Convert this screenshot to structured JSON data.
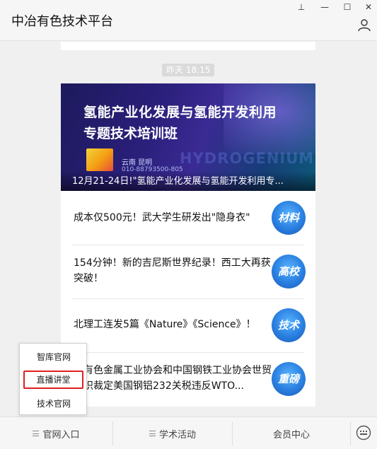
{
  "window": {
    "title": "中冶有色技术平台",
    "controls": {
      "pin": "⊥",
      "minimize": "—",
      "maximize": "☐",
      "close": "✕"
    }
  },
  "chat": {
    "timestamp": "昨天  18:15",
    "banner": {
      "title_line1": "氢能产业化发展与氢能开发利用",
      "title_line2": "专题技术培训班",
      "location": "云南 昆明",
      "phone": "010-88793500-805",
      "watermark": "HYDROGENIUM",
      "caption": "12月21-24日!\"氢能产业化发展与氢能开发利用专..."
    },
    "news": [
      {
        "text": "成本仅500元！武大学生研发出\"隐身衣\"",
        "thumb": "材料"
      },
      {
        "text": "154分钟！新的吉尼斯世界纪录！西工大再获突破！",
        "thumb": "高校"
      },
      {
        "text": "北理工连发5篇《Nature》《Science》！",
        "thumb": "技术"
      },
      {
        "text": "国有色金属工业协会和中国钢铁工业协会世贸组织裁定美国钢铝232关税违反WTO...",
        "thumb": "重磅"
      }
    ]
  },
  "popup_menu": {
    "items": [
      {
        "label": "智库官网"
      },
      {
        "label": "直播讲堂",
        "highlighted": true
      },
      {
        "label": "技术官网"
      }
    ],
    "highlight_color": "#e02020"
  },
  "bottom_menu": {
    "items": [
      {
        "label": "官网入口"
      },
      {
        "label": "学术活动"
      },
      {
        "label": "会员中心"
      }
    ]
  }
}
